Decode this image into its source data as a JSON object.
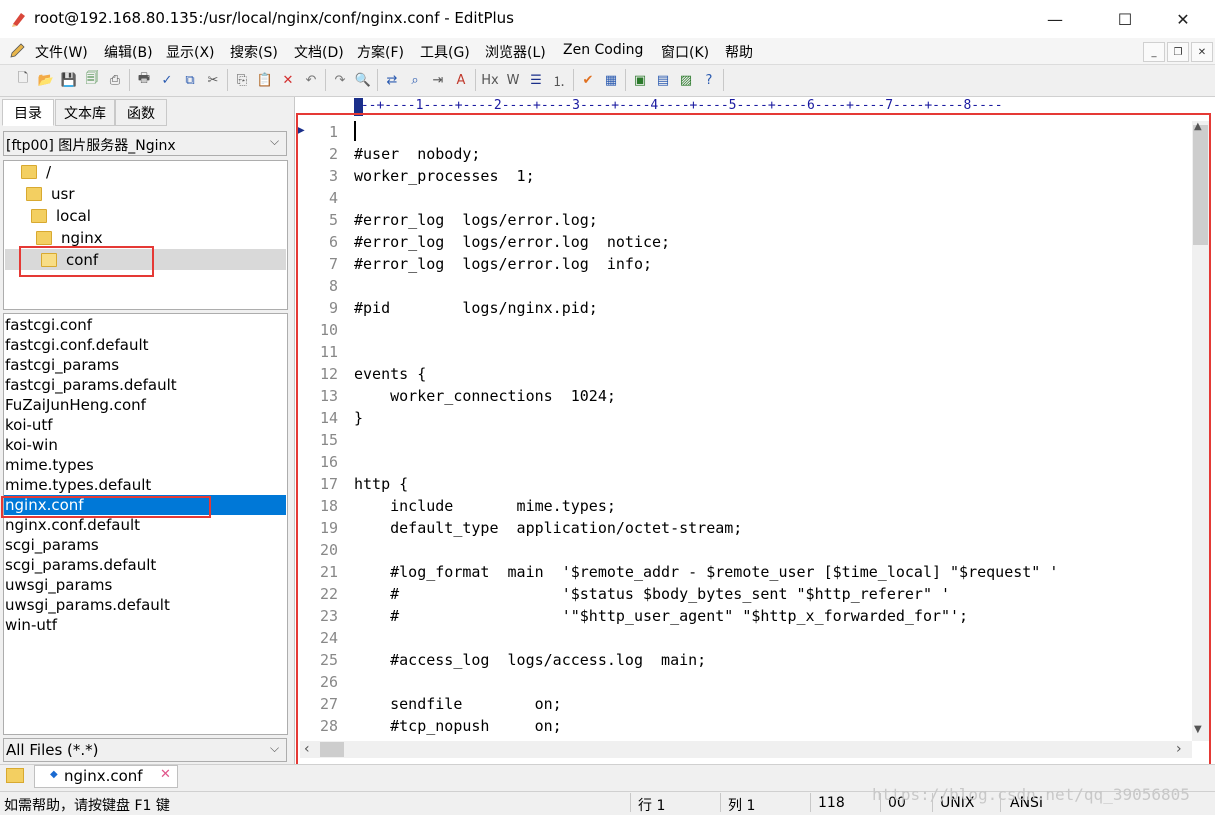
{
  "window": {
    "title": "root@192.168.80.135:/usr/local/nginx/conf/nginx.conf - EditPlus",
    "minimize_glyph": "—",
    "maximize_glyph": "☐",
    "close_glyph": "✕"
  },
  "menu": {
    "items": [
      "文件(W)",
      "编辑(B)",
      "显示(X)",
      "搜索(S)",
      "文档(D)",
      "方案(F)",
      "工具(G)",
      "浏览器(L)",
      "Zen Coding",
      "窗口(K)",
      "帮助"
    ]
  },
  "toolbar": {
    "icons": [
      "new-file-icon",
      "open-folder-icon",
      "save-icon",
      "save-all-icon",
      "print-preview-icon",
      "print-icon",
      "spell-check-icon",
      "browser-preview-icon",
      "cut-icon",
      "copy-icon",
      "paste-icon",
      "delete-icon",
      "undo-icon",
      "redo-icon",
      "find-icon",
      "replace-icon",
      "find-in-files-icon",
      "goto-line-icon",
      "font-icon",
      "hex-icon",
      "word-wrap-icon",
      "line-wrap-icon",
      "line-number-icon",
      "spell-icon",
      "user-tool-1-icon",
      "user-tool-2-icon",
      "user-tool-3-icon",
      "user-tool-4-icon",
      "help-cursor-icon"
    ]
  },
  "left_panel": {
    "tabs": [
      "目录",
      "文本库",
      "函数"
    ],
    "directory_select": "[ftp00] 图片服务器_Nginx",
    "tree": [
      {
        "label": "/",
        "selected": false
      },
      {
        "label": "usr",
        "selected": false
      },
      {
        "label": "local",
        "selected": false
      },
      {
        "label": "nginx",
        "selected": false
      },
      {
        "label": "conf",
        "selected": true
      }
    ],
    "files": [
      "fastcgi.conf",
      "fastcgi.conf.default",
      "fastcgi_params",
      "fastcgi_params.default",
      "FuZaiJunHeng.conf",
      "koi-utf",
      "koi-win",
      "mime.types",
      "mime.types.default",
      "nginx.conf",
      "nginx.conf.default",
      "scgi_params",
      "scgi_params.default",
      "uwsgi_params",
      "uwsgi_params.default",
      "win-utf"
    ],
    "selected_file": "nginx.conf",
    "filter": "All Files (*.*)"
  },
  "editor": {
    "ruler": "---+----1----+----2----+----3----+----4----+----5----+----6----+----7----+----8----",
    "lines": [
      {
        "n": "1",
        "text": ""
      },
      {
        "n": "2",
        "text": "#user  nobody;"
      },
      {
        "n": "3",
        "text": "worker_processes  1;"
      },
      {
        "n": "4",
        "text": ""
      },
      {
        "n": "5",
        "text": "#error_log  logs/error.log;"
      },
      {
        "n": "6",
        "text": "#error_log  logs/error.log  notice;"
      },
      {
        "n": "7",
        "text": "#error_log  logs/error.log  info;"
      },
      {
        "n": "8",
        "text": ""
      },
      {
        "n": "9",
        "text": "#pid        logs/nginx.pid;"
      },
      {
        "n": "10",
        "text": ""
      },
      {
        "n": "11",
        "text": ""
      },
      {
        "n": "12",
        "text": "events {"
      },
      {
        "n": "13",
        "text": "    worker_connections  1024;"
      },
      {
        "n": "14",
        "text": "}"
      },
      {
        "n": "15",
        "text": ""
      },
      {
        "n": "16",
        "text": ""
      },
      {
        "n": "17",
        "text": "http {"
      },
      {
        "n": "18",
        "text": "    include       mime.types;"
      },
      {
        "n": "19",
        "text": "    default_type  application/octet-stream;"
      },
      {
        "n": "20",
        "text": ""
      },
      {
        "n": "21",
        "text": "    #log_format  main  '$remote_addr - $remote_user [$time_local] \"$request\" '"
      },
      {
        "n": "22",
        "text": "    #                  '$status $body_bytes_sent \"$http_referer\" '"
      },
      {
        "n": "23",
        "text": "    #                  '\"$http_user_agent\" \"$http_x_forwarded_for\"';"
      },
      {
        "n": "24",
        "text": ""
      },
      {
        "n": "25",
        "text": "    #access_log  logs/access.log  main;"
      },
      {
        "n": "26",
        "text": ""
      },
      {
        "n": "27",
        "text": "    sendfile        on;"
      },
      {
        "n": "28",
        "text": "    #tcp_nopush     on;"
      }
    ]
  },
  "doc_tabs": {
    "active": "nginx.conf",
    "close_glyph": "✕"
  },
  "status": {
    "help": "如需帮助，请按键盘 F1 键",
    "row": "行 1",
    "col": "列 1",
    "count": "118",
    "code": "00",
    "line_ending": "UNIX",
    "encoding": "ANSI",
    "watermark": "https://blog.csdn.net/qq_39056805"
  },
  "colors": {
    "selection": "#0078d7",
    "highlight_box": "#e53935",
    "ruler_text": "#1a1aa0"
  }
}
